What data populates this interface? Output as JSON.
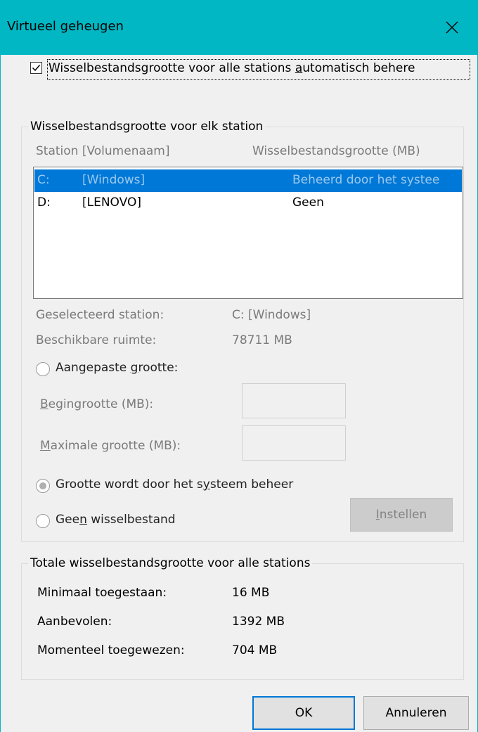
{
  "window": {
    "title": "Virtueel geheugen"
  },
  "auto_manage": {
    "checked": true,
    "label_pre": "Wisselbestandsgrootte voor alle stations ",
    "label_access": "a",
    "label_post": "utomatisch behere"
  },
  "per_drive": {
    "legend": "Wisselbestandsgrootte voor elk station",
    "col_drive": "Station [Volumenaam]",
    "col_size": "Wisselbestandsgrootte (MB)",
    "rows": [
      {
        "letter": "C:",
        "volume": "[Windows]",
        "size": "Beheerd door het systee"
      },
      {
        "letter": "D:",
        "volume": "[LENOVO]",
        "size": "Geen"
      }
    ],
    "selected_label": "Geselecteerd station:",
    "selected_value": "C:  [Windows]",
    "available_label": "Beschikbare ruimte:",
    "available_value": "78711 MB",
    "custom_pre": "Aangepaste ",
    "custom_access": "g",
    "custom_post": "rootte:",
    "initial_access": "B",
    "initial_post": "egingrootte (MB):",
    "initial_value": "",
    "max_access": "M",
    "max_post": "aximale grootte (MB):",
    "max_value": "",
    "system_pre": "Grootte wordt door het s",
    "system_access": "y",
    "system_post": "steem beheer",
    "none_pre": "Gee",
    "none_access": "n",
    "none_post": " wisselbestand",
    "set_access": "I",
    "set_post": "nstellen"
  },
  "totals": {
    "legend": "Totale wisselbestandsgrootte voor alle stations",
    "min_label": "Minimaal toegestaan:",
    "min_value": "16 MB",
    "rec_label": "Aanbevolen:",
    "rec_value": "1392 MB",
    "cur_label": "Momenteel toegewezen:",
    "cur_value": "704 MB"
  },
  "buttons": {
    "ok": "OK",
    "cancel": "Annuleren"
  },
  "colors": {
    "accent": "#00b7c3",
    "selection": "#0078d7"
  }
}
